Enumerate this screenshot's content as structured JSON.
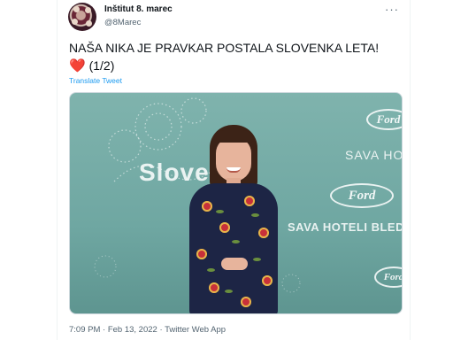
{
  "tweet": {
    "author_name": "Inštitut 8. marec",
    "author_handle": "@8Marec",
    "more_label": "···",
    "text": "NAŠA NIKA JE PRAVKAR POSTALA SLOVENKA LETA!",
    "emoji": "❤️",
    "suffix": "(1/2)",
    "translate_label": "Translate Tweet",
    "timestamp": "7:09 PM · Feb 13, 2022 · Twitter Web App"
  },
  "media": {
    "backdrop_texts": [
      "Slove",
      "SAVA HOTE",
      "SAVA HOTELI BLED",
      "Ford"
    ],
    "colors": {
      "backdrop": "#7fb3ad",
      "dress": "#1d2545",
      "flower": "#c8303a"
    }
  },
  "colors": {
    "link": "#1d9bf0",
    "secondary": "#536471",
    "heart": "#dd2e44"
  }
}
